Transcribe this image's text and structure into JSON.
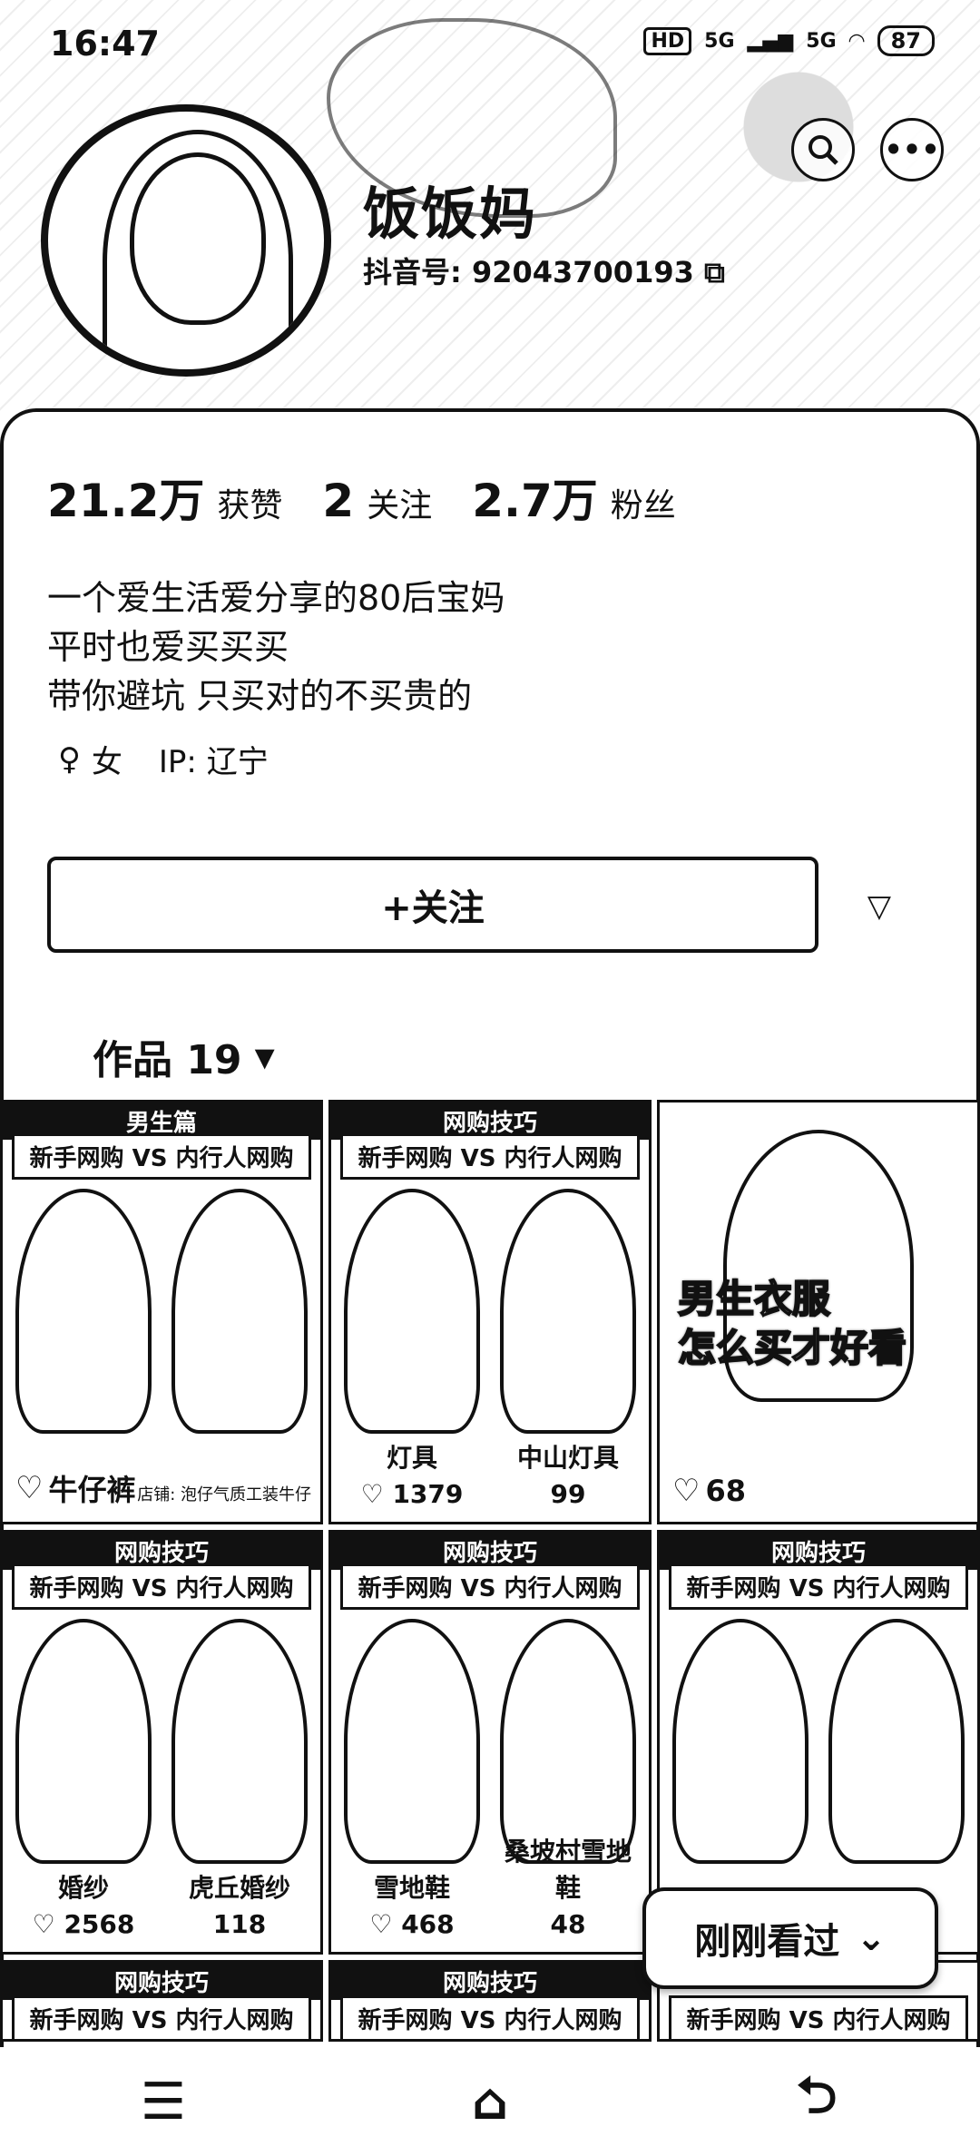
{
  "status_bar": {
    "time": "16:47",
    "hd": "HD",
    "sig1": "5G",
    "sig2": "5G",
    "battery": "87"
  },
  "profile": {
    "nickname": "饭饭妈",
    "douyin_id": "抖音号: 92043700193",
    "stats": [
      {
        "num": "21.2万",
        "label": "获赞"
      },
      {
        "num": "2",
        "label": "关注"
      },
      {
        "num": "2.7万",
        "label": "粉丝"
      }
    ],
    "bio": [
      "一个爱生活爱分享的80后宝妈",
      "平时也爱买买买",
      "带你避坑 只买对的不买贵的"
    ],
    "gender": "女",
    "ip": "IP: 辽宁",
    "follow_label": "+关注"
  },
  "works_tab": {
    "label": "作品 19"
  },
  "grid": [
    {
      "title": "男生篇",
      "sub": "新手网购 VS 内行人网购",
      "likes": "",
      "left_label": "牛仔裤",
      "left_price": "",
      "right_label": "",
      "right_price": "",
      "store": "店铺: 泡仔气质工装牛仔"
    },
    {
      "title": "网购技巧",
      "sub": "新手网购 VS 内行人网购",
      "likes": "",
      "left_label": "灯具",
      "left_price": "1379",
      "right_label": "中山灯具",
      "right_price": "99"
    },
    {
      "overlay": "男生衣服\n怎么买才好看",
      "likes": "68"
    },
    {
      "title": "网购技巧",
      "sub": "新手网购 VS 内行人网购",
      "left_label": "婚纱",
      "left_price": "2568",
      "right_label": "虎丘婚纱",
      "right_price": "118"
    },
    {
      "title": "网购技巧",
      "sub": "新手网购 VS 内行人网购",
      "left_label": "雪地鞋",
      "left_price": "468",
      "right_label": "桑坡村雪地鞋",
      "right_price": "48"
    },
    {
      "title": "网购技巧",
      "sub": "新手网购 VS 内行人网购",
      "left_label": "",
      "left_price": "",
      "right_label": "",
      "right_price": ""
    },
    {
      "title": "网购技巧",
      "sub": "新手网购 VS 内行人网购"
    },
    {
      "title": "网购技巧",
      "sub": "新手网购 VS 内行人网购"
    },
    {
      "title": "",
      "sub": "新手网购 VS 内行人网购"
    }
  ],
  "recent": {
    "label": "刚刚看过"
  },
  "icons": {
    "search": "search-icon",
    "more": "more-icon",
    "copy": "copy-icon",
    "heart": "heart-icon"
  }
}
